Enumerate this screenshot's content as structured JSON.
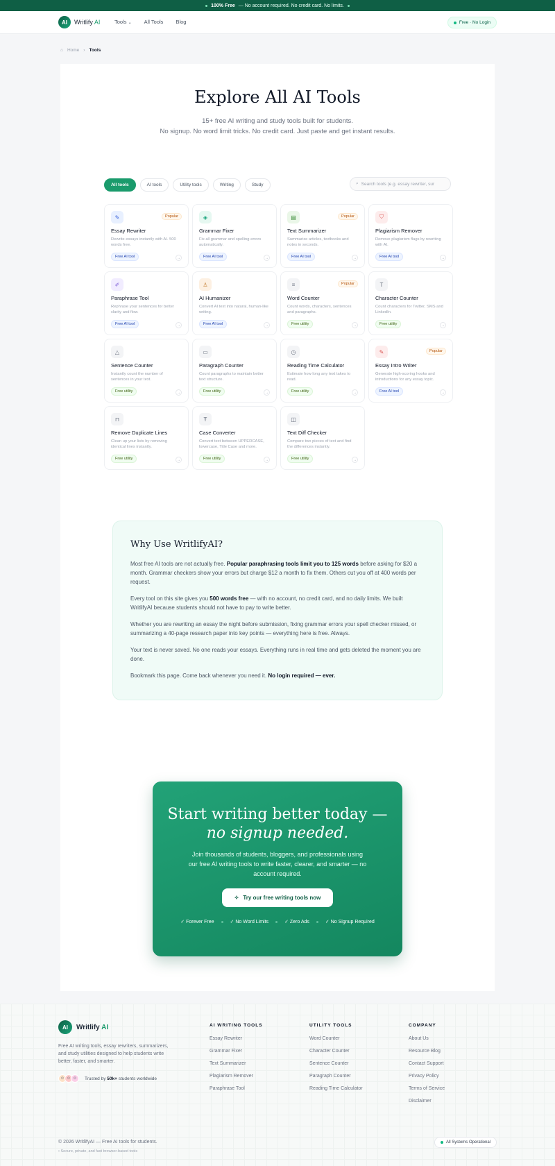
{
  "topbar": {
    "bold": "100% Free",
    "text": "— No account required. No credit card. No limits."
  },
  "nav": {
    "logo_mark": "AI",
    "brand_main": "Writlify",
    "brand_accent": "AI",
    "links": [
      "Tools",
      "All Tools",
      "Blog"
    ],
    "pill": "Free · No Login"
  },
  "breadcrumb": {
    "home": "Home",
    "current": "Tools"
  },
  "hero": {
    "title": "Explore All AI Tools",
    "sub1": "15+ free AI writing and study tools built for students.",
    "sub2": "No signup. No word limit tricks. No credit card. Just paste and get instant results."
  },
  "filters": [
    "All tools",
    "AI tools",
    "Utility tools",
    "Writing",
    "Study"
  ],
  "search": {
    "placeholder": "Search tools (e.g. essay rewriter, sur"
  },
  "tools": [
    {
      "name": "Essay Rewriter",
      "desc": "Rewrite essays instantly with AI. 500 words free.",
      "tag": "Free AI tool",
      "type": "ai",
      "popular": "Popular",
      "icon": "pencil-square-icon",
      "glyph": "✎",
      "bg": "#e8f0ff",
      "fg": "#3b63d9"
    },
    {
      "name": "Grammar Fixer",
      "desc": "Fix all grammar and spelling errors automatically.",
      "tag": "Free AI tool",
      "type": "ai",
      "popular": "",
      "icon": "layers-icon",
      "glyph": "◈",
      "bg": "#e6f8f1",
      "fg": "#16a37a"
    },
    {
      "name": "Text Summarizer",
      "desc": "Summarize articles, textbooks and notes in seconds.",
      "tag": "Free AI tool",
      "type": "ai",
      "popular": "Popular",
      "icon": "document-icon",
      "glyph": "▤",
      "bg": "#eaf7e8",
      "fg": "#3f8f3a"
    },
    {
      "name": "Plagiarism Remover",
      "desc": "Remove plagiarism flags by rewriting with AI.",
      "tag": "Free AI tool",
      "type": "ai",
      "popular": "",
      "icon": "shield-icon",
      "glyph": "⛉",
      "bg": "#fdecec",
      "fg": "#d9534f"
    },
    {
      "name": "Paraphrase Tool",
      "desc": "Rephrase your sentences for better clarity and flow.",
      "tag": "Free AI tool",
      "type": "ai",
      "popular": "",
      "icon": "pen-icon",
      "glyph": "✐",
      "bg": "#f1ecff",
      "fg": "#7c5cd6"
    },
    {
      "name": "AI Humanizer",
      "desc": "Convert AI text into natural, human-like writing.",
      "tag": "Free AI tool",
      "type": "ai",
      "popular": "",
      "icon": "user-icon",
      "glyph": "♙",
      "bg": "#fdf0e2",
      "fg": "#c27a2c"
    },
    {
      "name": "Word Counter",
      "desc": "Count words, characters, sentences and paragraphs.",
      "tag": "Free utility",
      "type": "util",
      "popular": "Popular",
      "icon": "lines-icon",
      "glyph": "≡",
      "bg": "#f3f4f6",
      "fg": "#6b7280"
    },
    {
      "name": "Character Counter",
      "desc": "Count characters for Twitter, SMS and LinkedIn.",
      "tag": "Free utility",
      "type": "util",
      "popular": "",
      "icon": "text-icon",
      "glyph": "T",
      "bg": "#f3f4f6",
      "fg": "#6b7280"
    },
    {
      "name": "Sentence Counter",
      "desc": "Instantly count the number of sentences in your text.",
      "tag": "Free utility",
      "type": "util",
      "popular": "",
      "icon": "triangle-icon",
      "glyph": "△",
      "bg": "#f3f4f6",
      "fg": "#6b7280"
    },
    {
      "name": "Paragraph Counter",
      "desc": "Count paragraphs to maintain better text structure.",
      "tag": "Free utility",
      "type": "util",
      "popular": "",
      "icon": "database-icon",
      "glyph": "▭",
      "bg": "#f3f4f6",
      "fg": "#6b7280"
    },
    {
      "name": "Reading Time Calculator",
      "desc": "Estimate how long any text takes to read.",
      "tag": "Free utility",
      "type": "util",
      "popular": "",
      "icon": "clock-icon",
      "glyph": "◷",
      "bg": "#f3f4f6",
      "fg": "#6b7280"
    },
    {
      "name": "Essay Intro Writer",
      "desc": "Generate high-scoring hooks and introductions for any essay topic.",
      "tag": "Free AI tool",
      "type": "ai",
      "popular": "Popular",
      "icon": "edit-icon",
      "glyph": "✎",
      "bg": "#fdecec",
      "fg": "#d9534f"
    },
    {
      "name": "Remove Duplicate Lines",
      "desc": "Clean up your lists by removing identical lines instantly.",
      "tag": "Free utility",
      "type": "util",
      "popular": "",
      "icon": "lock-icon",
      "glyph": "⊓",
      "bg": "#f3f4f6",
      "fg": "#6b7280"
    },
    {
      "name": "Case Converter",
      "desc": "Convert text between UPPERCASE, lowercase, Title Case and more.",
      "tag": "Free utility",
      "type": "util",
      "popular": "",
      "icon": "type-icon",
      "glyph": "Ŧ",
      "bg": "#f3f4f6",
      "fg": "#6b7280"
    },
    {
      "name": "Text Diff Checker",
      "desc": "Compare two pieces of text and find the differences instantly.",
      "tag": "Free utility",
      "type": "util",
      "popular": "",
      "icon": "diff-icon",
      "glyph": "◫",
      "bg": "#f3f4f6",
      "fg": "#6b7280"
    }
  ],
  "why": {
    "title": "Why Use WritlifyAI?",
    "p1_a": "Most free AI tools are not actually free. ",
    "p1_b": "Popular paraphrasing tools limit you to 125 words",
    "p1_c": " before asking for $20 a month. Grammar checkers show your errors but charge $12 a month to fix them. Others cut you off at 400 words per request.",
    "p2_a": "Every tool on this site gives you ",
    "p2_b": "500 words free",
    "p2_c": " — with no account, no credit card, and no daily limits. We built WritlifyAI because students should not have to pay to write better.",
    "p3": "Whether you are rewriting an essay the night before submission, fixing grammar errors your spell checker missed, or summarizing a 40-page research paper into key points — everything here is free. Always.",
    "p4": "Your text is never saved. No one reads your essays. Everything runs in real time and gets deleted the moment you are done.",
    "p5_a": "Bookmark this page. Come back whenever you need it. ",
    "p5_b": "No login required — ever."
  },
  "cta": {
    "title": "Start writing better today —",
    "title_em": "no signup needed.",
    "text": "Join thousands of students, bloggers, and professionals using our free AI writing tools to write faster, clearer, and smarter — no account required.",
    "button": "Try our free writing tools now",
    "checks": [
      "Forever Free",
      "No Word Limits",
      "Zero Ads",
      "No Signup Required"
    ]
  },
  "footer": {
    "brand_main": "Writlify",
    "brand_accent": "AI",
    "desc": "Free AI writing tools, essay rewriters, summarizers, and study utilities designed to help students write better, faster, and smarter.",
    "trusted_a": "Trusted by ",
    "trusted_b": "50k+",
    "trusted_c": " students worldwide",
    "cols": [
      {
        "title": "AI WRITING TOOLS",
        "items": [
          "Essay Rewriter",
          "Grammar Fixer",
          "Text Summarizer",
          "Plagiarism Remover",
          "Paraphrase Tool"
        ]
      },
      {
        "title": "UTILITY TOOLS",
        "items": [
          "Word Counter",
          "Character Counter",
          "Sentence Counter",
          "Paragraph Counter",
          "Reading Time Calculator"
        ]
      },
      {
        "title": "COMPANY",
        "items": [
          "About Us",
          "Resource Blog",
          "Contact Support",
          "Privacy Policy",
          "Terms of Service",
          "Disclaimer"
        ]
      }
    ],
    "copyright": "© 2026 WritlifyAI — Free AI tools for students.",
    "secure": "Secure, private, and fast browser-based tools",
    "status": "All Systems Operational"
  }
}
